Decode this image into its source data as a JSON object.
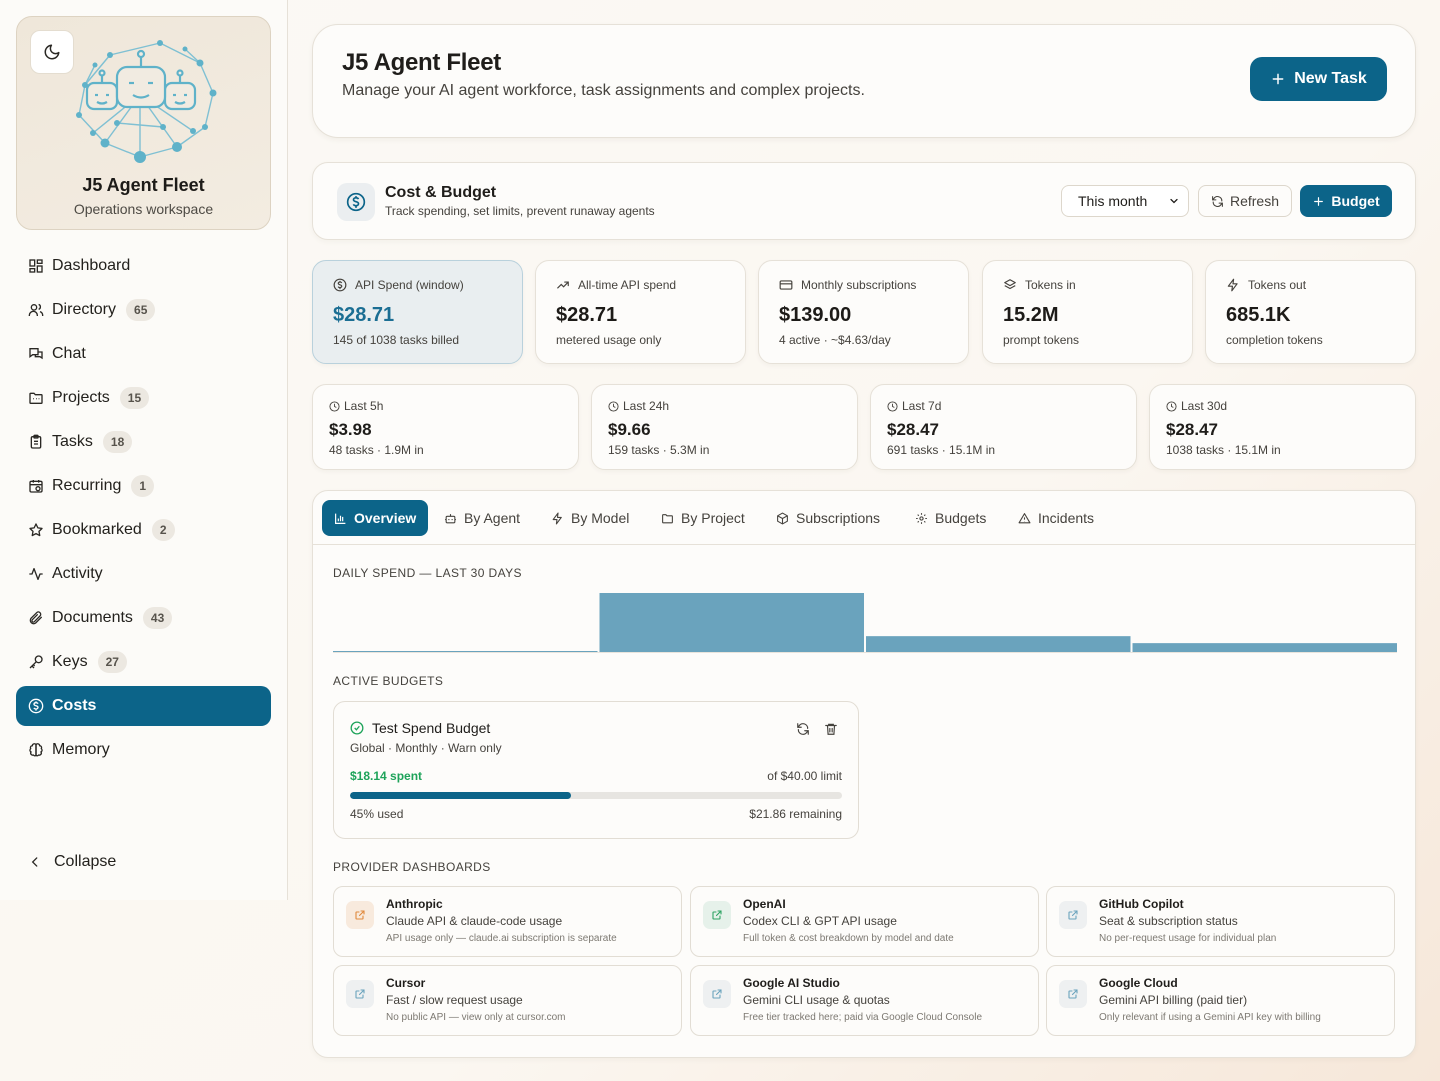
{
  "sidebar": {
    "brand_title": "J5 Agent Fleet",
    "brand_subtitle": "Operations workspace",
    "items": [
      {
        "label": "Dashboard",
        "icon": "dashboard-icon",
        "badge": ""
      },
      {
        "label": "Directory",
        "icon": "users-icon",
        "badge": "65"
      },
      {
        "label": "Chat",
        "icon": "chat-icon",
        "badge": ""
      },
      {
        "label": "Projects",
        "icon": "folder-icon",
        "badge": "15"
      },
      {
        "label": "Tasks",
        "icon": "clipboard-icon",
        "badge": "18"
      },
      {
        "label": "Recurring",
        "icon": "calendar-repeat-icon",
        "badge": "1"
      },
      {
        "label": "Bookmarked",
        "icon": "star-icon",
        "badge": "2"
      },
      {
        "label": "Activity",
        "icon": "activity-icon",
        "badge": ""
      },
      {
        "label": "Documents",
        "icon": "paperclip-icon",
        "badge": "43"
      },
      {
        "label": "Keys",
        "icon": "key-icon",
        "badge": "27"
      },
      {
        "label": "Costs",
        "icon": "dollar-circle-icon",
        "badge": "",
        "active": true
      },
      {
        "label": "Memory",
        "icon": "brain-icon",
        "badge": ""
      }
    ],
    "collapse_label": "Collapse"
  },
  "header": {
    "title": "J5 Agent Fleet",
    "subtitle": "Manage your AI agent workforce, task assignments and complex projects.",
    "new_task_label": "New Task"
  },
  "cost": {
    "title": "Cost & Budget",
    "subtitle": "Track spending, set limits, prevent runaway agents",
    "period_selected": "This month",
    "refresh_label": "Refresh",
    "budget_label": "Budget"
  },
  "stats": [
    {
      "label": "API Spend (window)",
      "value": "$28.71",
      "sub": "145 of 1038 tasks billed",
      "icon": "dollar-circle-icon"
    },
    {
      "label": "All-time API spend",
      "value": "$28.71",
      "sub": "metered usage only",
      "icon": "trending-up-icon"
    },
    {
      "label": "Monthly subscriptions",
      "value": "$139.00",
      "sub": "4 active · ~$4.63/day",
      "icon": "credit-card-icon"
    },
    {
      "label": "Tokens in",
      "value": "15.2M",
      "sub": "prompt tokens",
      "icon": "layers-icon"
    },
    {
      "label": "Tokens out",
      "value": "685.1K",
      "sub": "completion tokens",
      "icon": "zap-icon"
    }
  ],
  "windows": [
    {
      "label": "Last 5h",
      "value": "$3.98",
      "sub": "48 tasks · 1.9M in"
    },
    {
      "label": "Last 24h",
      "value": "$9.66",
      "sub": "159 tasks · 5.3M in"
    },
    {
      "label": "Last 7d",
      "value": "$28.47",
      "sub": "691 tasks · 15.1M in"
    },
    {
      "label": "Last 30d",
      "value": "$28.47",
      "sub": "1038 tasks · 15.1M in"
    }
  ],
  "tabs": [
    {
      "label": "Overview",
      "icon": "bar-chart-icon"
    },
    {
      "label": "By Agent",
      "icon": "bot-icon"
    },
    {
      "label": "By Model",
      "icon": "zap-icon"
    },
    {
      "label": "By Project",
      "icon": "folder-icon"
    },
    {
      "label": "Subscriptions",
      "icon": "package-icon"
    },
    {
      "label": "Budgets",
      "icon": "gear-icon"
    },
    {
      "label": "Incidents",
      "icon": "warning-icon"
    }
  ],
  "overview": {
    "daily_spend_label": "DAILY SPEND — LAST 30 DAYS",
    "active_budgets_label": "ACTIVE BUDGETS",
    "provider_dashboards_label": "PROVIDER DASHBOARDS"
  },
  "chart_data": {
    "type": "bar",
    "categories": [
      "",
      "",
      "",
      ""
    ],
    "values": [
      0.29,
      9.37,
      2.63,
      1.54
    ],
    "title": "DAILY SPEND — LAST 30 DAYS",
    "xlabel": "",
    "ylabel": "",
    "color": "#6aa3bd"
  },
  "budget": {
    "name": "Test Spend Budget",
    "meta": "Global · Monthly · Warn only",
    "spent": "$18.14 spent",
    "limit": "of $40.00 limit",
    "used_fraction": 0.45,
    "used_label": "45% used",
    "remaining": "$21.86 remaining"
  },
  "providers": [
    {
      "name": "Anthropic",
      "desc": "Claude API & claude-code usage",
      "note": "API usage only — claude.ai subscription is separate",
      "tone": "orange"
    },
    {
      "name": "OpenAI",
      "desc": "Codex CLI & GPT API usage",
      "note": "Full token & cost breakdown by model and date",
      "tone": "green"
    },
    {
      "name": "GitHub Copilot",
      "desc": "Seat & subscription status",
      "note": "No per-request usage for individual plan",
      "tone": "gray"
    },
    {
      "name": "Cursor",
      "desc": "Fast / slow request usage",
      "note": "No public API — view only at cursor.com",
      "tone": "gray"
    },
    {
      "name": "Google AI Studio",
      "desc": "Gemini CLI usage & quotas",
      "note": "Free tier tracked here; paid via Google Cloud Console",
      "tone": "gray"
    },
    {
      "name": "Google Cloud",
      "desc": "Gemini API billing (paid tier)",
      "note": "Only relevant if using a Gemini API key with billing",
      "tone": "gray"
    }
  ],
  "colors": {
    "accent": "#0c6489",
    "chart_bar": "#6aa3bd",
    "success": "#1ea35a"
  }
}
